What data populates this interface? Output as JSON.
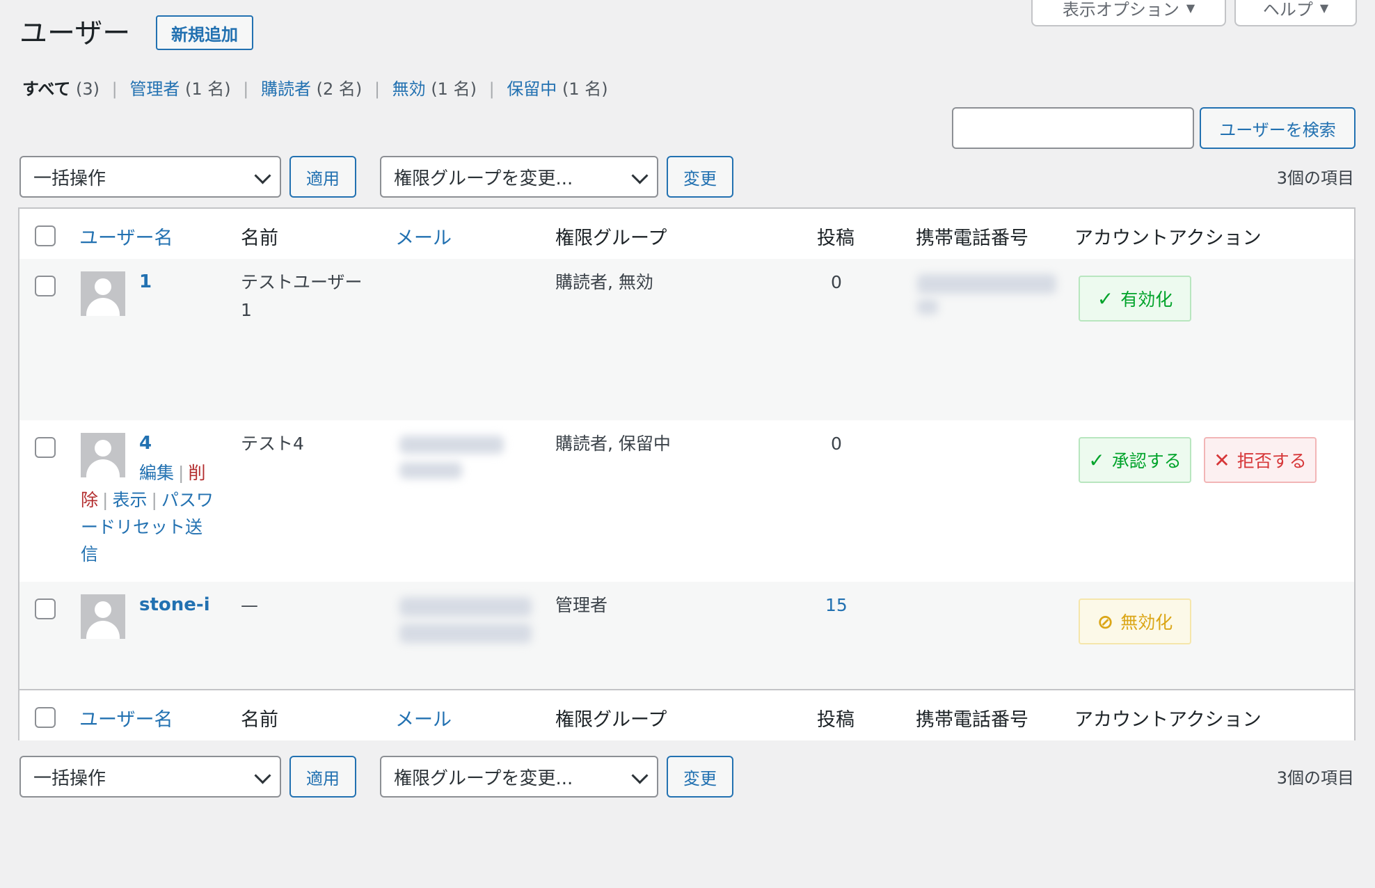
{
  "screen_meta": {
    "display_options": "表示オプション",
    "help": "ヘルプ"
  },
  "header": {
    "title": "ユーザー",
    "add_new": "新規追加"
  },
  "filters": [
    {
      "label": "すべて",
      "count": "(3)"
    },
    {
      "label": "管理者",
      "count": "(1 名)"
    },
    {
      "label": "購読者",
      "count": "(2 名)"
    },
    {
      "label": "無効",
      "count": "(1 名)"
    },
    {
      "label": "保留中",
      "count": "(1 名)"
    }
  ],
  "search": {
    "placeholder": "",
    "button": "ユーザーを検索"
  },
  "tablenav": {
    "bulk_select": "一括操作",
    "apply": "適用",
    "role_select": "権限グループを変更...",
    "change": "変更",
    "items_count": "3個の項目"
  },
  "columns": {
    "username": "ユーザー名",
    "name": "名前",
    "email": "メール",
    "role": "権限グループ",
    "posts": "投稿",
    "phone": "携帯電話番号",
    "account_action": "アカウントアクション"
  },
  "rows": [
    {
      "username": "1",
      "name": "テストユーザー 1",
      "role": "購読者, 無効",
      "posts": "0",
      "actions": [
        {
          "label": "有効化",
          "icon": "check-icon",
          "style": "green"
        }
      ]
    },
    {
      "username": "4",
      "name": "テスト4",
      "role": "購読者, 保留中",
      "posts": "0",
      "row_actions": {
        "edit": "編集",
        "delete": "削除",
        "view": "表示",
        "reset": "パスワードリセット送信"
      },
      "actions": [
        {
          "label": "承認する",
          "icon": "check-icon",
          "style": "green"
        },
        {
          "label": "拒否する",
          "icon": "x-icon",
          "style": "red"
        }
      ]
    },
    {
      "username": "stone-i",
      "name": "—",
      "role": "管理者",
      "posts": "15",
      "actions": [
        {
          "label": "無効化",
          "icon": "no-entry-icon",
          "style": "yellow"
        }
      ]
    }
  ],
  "colors": {
    "link": "#2271b1",
    "danger": "#b32d2e",
    "success": "#00a32a",
    "warning": "#dba617"
  }
}
